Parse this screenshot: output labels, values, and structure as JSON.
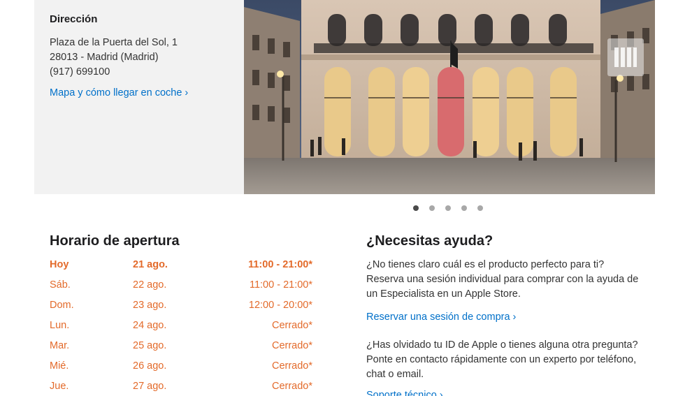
{
  "address": {
    "heading": "Dirección",
    "line1": "Plaza de la Puerta del Sol, 1",
    "line2": "28013 - Madrid (Madrid)",
    "phone": "(917) 699100",
    "map_link": "Mapa y cómo llegar en coche ›"
  },
  "gallery": {
    "slide_count": 5,
    "active_index": 0
  },
  "hours": {
    "title": "Horario de apertura",
    "rows": [
      {
        "day": "Hoy",
        "date": "21 ago.",
        "time": "11:00 - 21:00*"
      },
      {
        "day": "Sáb.",
        "date": "22 ago.",
        "time": "11:00 - 21:00*"
      },
      {
        "day": "Dom.",
        "date": "23 ago.",
        "time": "12:00 - 20:00*"
      },
      {
        "day": "Lun.",
        "date": "24 ago.",
        "time": "Cerrado*"
      },
      {
        "day": "Mar.",
        "date": "25 ago.",
        "time": "Cerrado*"
      },
      {
        "day": "Mié.",
        "date": "26 ago.",
        "time": "Cerrado*"
      },
      {
        "day": "Jue.",
        "date": "27 ago.",
        "time": "Cerrado*"
      }
    ]
  },
  "help": {
    "title": "¿Necesitas ayuda?",
    "paragraph1": "¿No tienes claro cuál es el producto perfecto para ti? Reserva una sesión individual para comprar con la ayuda de un Especialista en un Apple Store.",
    "link1": "Reservar una sesión de compra ›",
    "paragraph2": "¿Has olvidado tu ID de Apple o tienes alguna otra pregunta? Ponte en contacto rápidamente con un experto por teléfono, chat o email.",
    "link2": "Soporte técnico ›"
  },
  "colors": {
    "link": "#0070c9",
    "hours_accent": "#e36a2a",
    "panel_bg": "#f2f2f2"
  }
}
